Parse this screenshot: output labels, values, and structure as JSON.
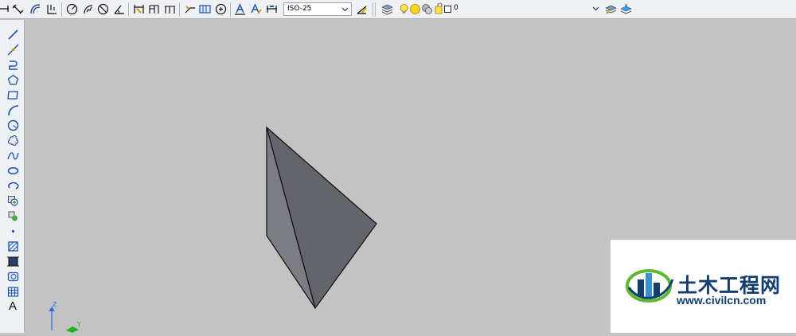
{
  "toolbar": {
    "dimension_style_value": "ISO-25",
    "layer_value": "0"
  },
  "draw_panel": {
    "text_tool_glyph": "A"
  },
  "ucs": {
    "z_label": "Z",
    "y_label": "Y"
  },
  "watermark": {
    "title": "土木工程网",
    "url": "www.civilcn.com"
  },
  "colors": {
    "canvas": "#c3c3c3",
    "toolbar": "#eef0f4",
    "solid_face_light": "#7c7c84",
    "solid_face_dark": "#64646c",
    "watermark_blue": "#123d6e",
    "watermark_green": "#5db82f"
  },
  "icons": [
    "linear-dimension-icon",
    "aligned-dimension-icon",
    "arc-length-icon",
    "ordinate-dimension-icon",
    "radius-dimension-icon",
    "jogged-dimension-icon",
    "diameter-dimension-icon",
    "angular-dimension-icon",
    "quick-dimension-icon",
    "baseline-dimension-icon",
    "continue-dimension-icon",
    "quick-leader-icon",
    "tolerance-icon",
    "center-mark-icon",
    "dimension-edit-icon",
    "dimension-text-edit-icon",
    "dimension-update-icon",
    "dimension-style-icon",
    "layer-properties-icon",
    "layer-on-icon",
    "layer-freeze-icon",
    "layer-lock-icon",
    "layer-color-icon",
    "make-current-layer-icon",
    "layer-previous-icon",
    "line-icon",
    "construction-line-icon",
    "polyline-icon",
    "polygon-icon",
    "rectangle-icon",
    "arc-icon",
    "circle-icon",
    "revision-cloud-icon",
    "spline-icon",
    "ellipse-icon",
    "ellipse-arc-icon",
    "insert-block-icon",
    "make-block-icon",
    "point-icon",
    "hatch-icon",
    "gradient-icon",
    "region-icon",
    "table-icon",
    "multiline-text-icon"
  ]
}
